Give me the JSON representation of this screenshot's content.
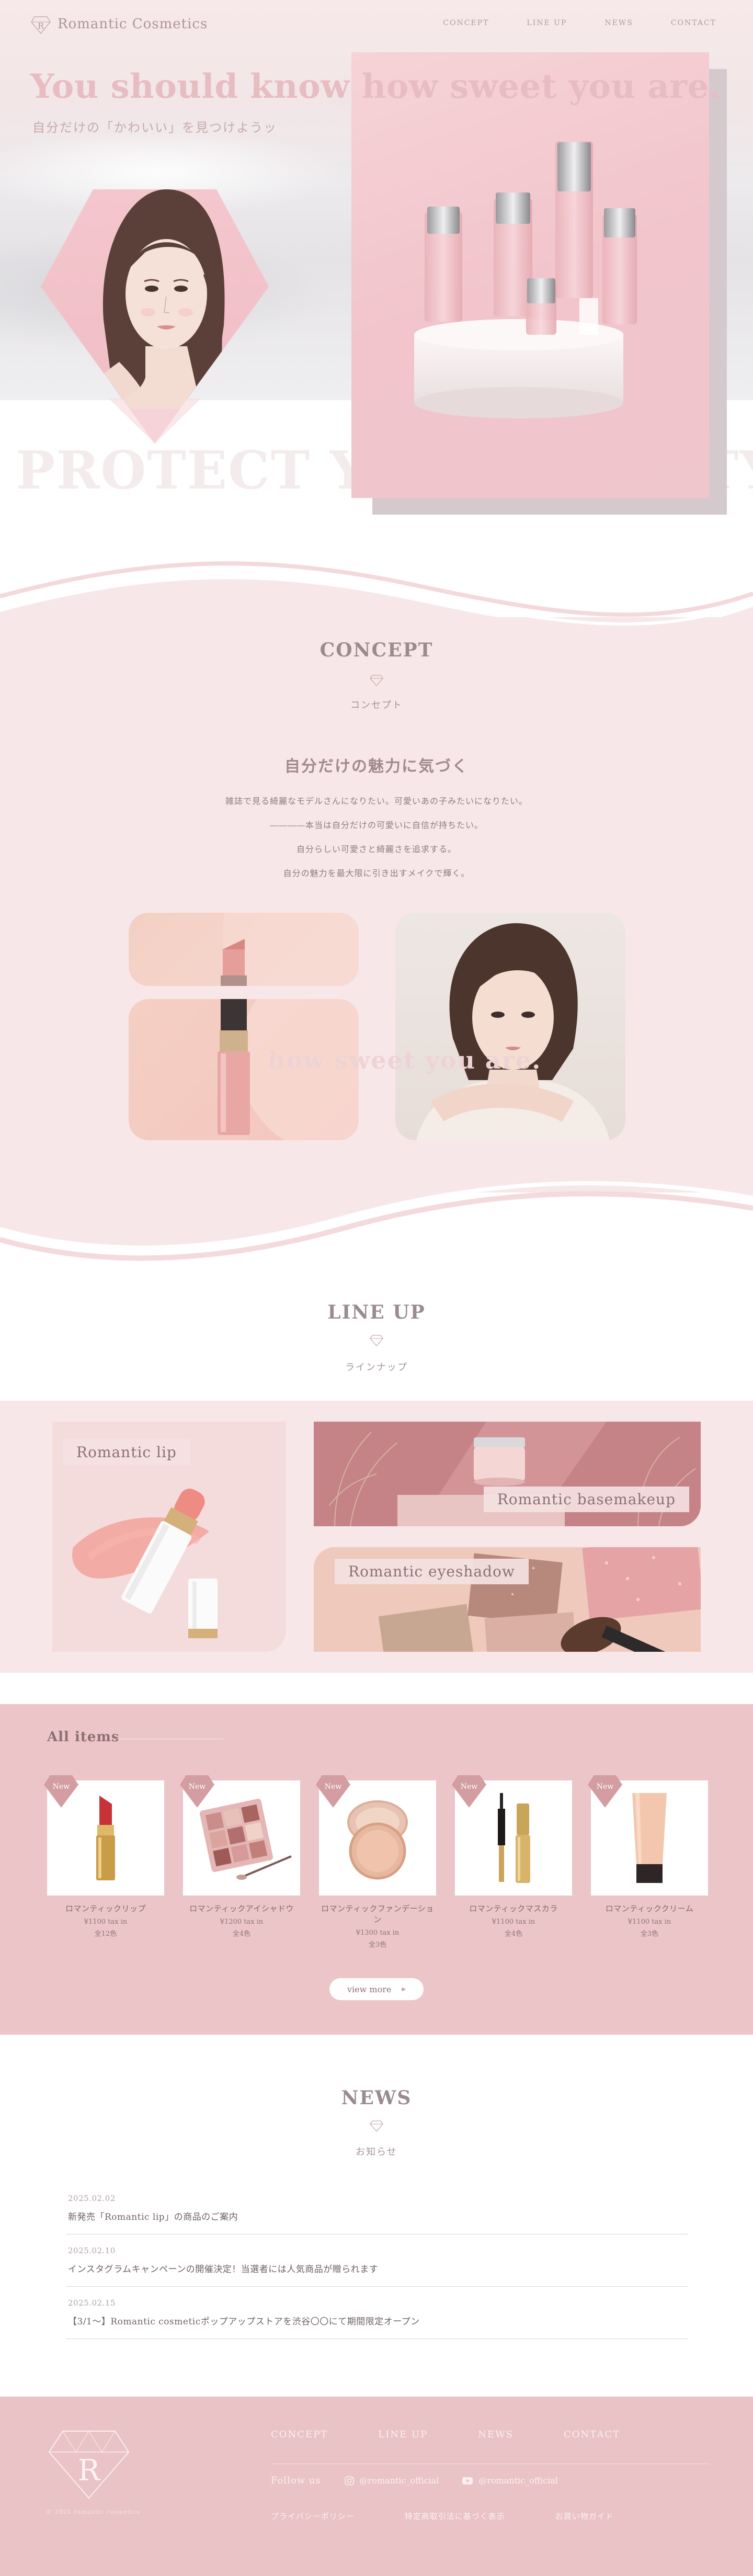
{
  "header": {
    "brand": "Romantic Cosmetics",
    "nav": [
      "CONCEPT",
      "LINE UP",
      "NEWS",
      "CONTACT"
    ]
  },
  "hero": {
    "title": "You should know how sweet you are.",
    "subtitle": "自分だけの「かわいい」を見つけようッ",
    "bg_text": "PROTECT YOUR BEAUTY"
  },
  "concept": {
    "title": "CONCEPT",
    "subtitle": "コンセプト",
    "heading": "自分だけの魅力に気づく",
    "lines": [
      "雑誌で見る綺麗なモデルさんになりたい。可愛いあの子みたいになりたい。",
      "――――本当は自分だけの可愛いに自信が持ちたい。",
      "自分らしい可愛さと綺麗さを追求する。",
      "自分の魅力を最大限に引き出すメイクで輝く。"
    ],
    "overlay": "how sweet you are."
  },
  "lineup": {
    "title": "LINE UP",
    "subtitle": "ラインナップ",
    "cards": [
      "Romantic lip",
      "Romantic basemakeup",
      "Romantic eyeshadow"
    ]
  },
  "items": {
    "heading": "All items",
    "badge": "New",
    "list": [
      {
        "name": "ロマンティックリップ",
        "price": "¥1100 tax in",
        "colors": "全12色"
      },
      {
        "name": "ロマンティックアイシャドウ",
        "price": "¥1200 tax in",
        "colors": "全4色"
      },
      {
        "name": "ロマンティックファンデーション",
        "price": "¥1300 tax in",
        "colors": "全3色"
      },
      {
        "name": "ロマンティックマスカラ",
        "price": "¥1100 tax in",
        "colors": "全4色"
      },
      {
        "name": "ロマンティッククリーム",
        "price": "¥1100 tax in",
        "colors": "全3色"
      }
    ],
    "view_more": "view more"
  },
  "news": {
    "title": "NEWS",
    "subtitle": "お知らせ",
    "list": [
      {
        "date": "2025.02.02",
        "text": "新発売「Romantic lip」の商品のご案内"
      },
      {
        "date": "2025.02.10",
        "text": "インスタグラムキャンペーンの開催決定！当選者には人気商品が贈られます"
      },
      {
        "date": "2025.02.15",
        "text": "【3/1〜】Romantic cosmeticポップアップストアを渋谷〇〇にて期間限定オープン"
      }
    ]
  },
  "footer": {
    "copyright": "© 2025 romantic cosmetics",
    "nav": [
      "CONCEPT",
      "LINE UP",
      "NEWS",
      "CONTACT"
    ],
    "follow_label": "Follow us",
    "instagram": "@romantic_official",
    "youtube": "@romantic_official",
    "links": [
      "プライバシーポリシー",
      "特定商取引法に基づく表示",
      "お買い物ガイド"
    ]
  }
}
